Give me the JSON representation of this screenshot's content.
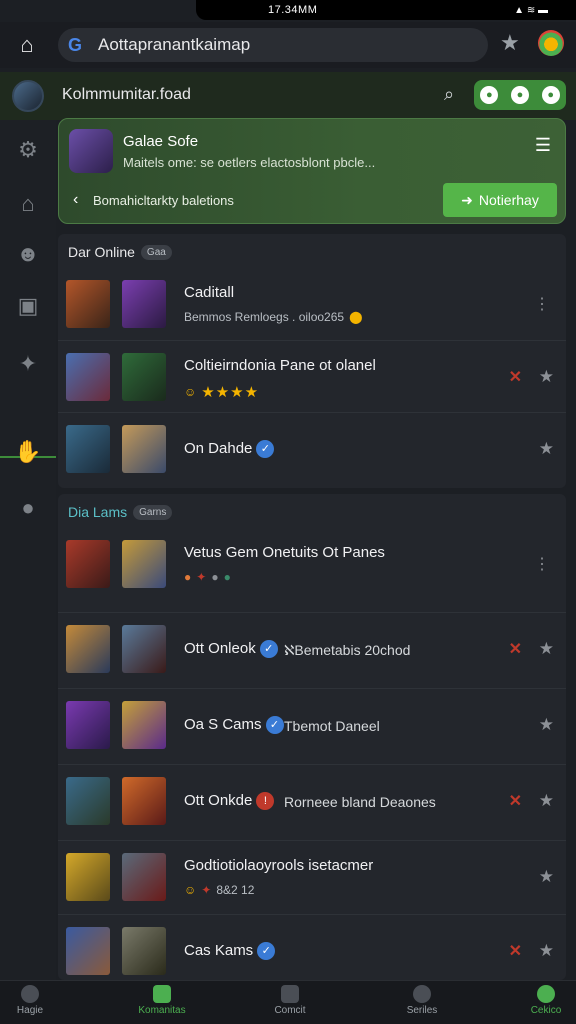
{
  "status_bar": {
    "time": "17.34MM",
    "icons": "▲ ≋ ▬"
  },
  "browser": {
    "url": "Aottapranantkaimap",
    "google_logo": "G",
    "icons": {
      "home": "home-icon",
      "star": "star-icon",
      "extension": "extension-icon"
    }
  },
  "header": {
    "title": "Kolmmumitar.foad",
    "icons": [
      "search-icon",
      "chat-icon",
      "chat-icon",
      "chat-icon"
    ]
  },
  "sidebar": {
    "items": [
      "settings-icon",
      "home-icon",
      "friends-icon",
      "lock-icon",
      "gamepad-icon",
      "thumbs-icon",
      "chat-icon"
    ]
  },
  "banner": {
    "title": "Galae Sofe",
    "subtitle": "Maitels ome: se oetlers elactosblont pbcle...",
    "link": "Bomahicltarkty baletions",
    "button": "Notierhay"
  },
  "section1": {
    "heading": "Dar Online",
    "tag": "Gaa",
    "rows": [
      {
        "name": "Caditall",
        "sub": "Bemmos Remloegs . oiloo265"
      },
      {
        "name": "Coltieirndonia Pane ot olanel",
        "rating": "★★★★"
      },
      {
        "name": "On Dahde"
      }
    ]
  },
  "section2": {
    "heading": "Dia Lams",
    "tag": "Garns",
    "rows": [
      {
        "name": "Vetus Gem Onetuits Ot Panes"
      },
      {
        "name": "Ott Onleok",
        "desc": "ℵBemetabis 20chod"
      },
      {
        "name": "Oa S Cams",
        "desc": "Tbemot Daneel"
      },
      {
        "name": "Ott Onkde",
        "desc": "Rorneee bland Deaones"
      },
      {
        "name": "Godtiotiolaoyrools isetacmer",
        "sub": "8&2 12"
      },
      {
        "name": "Cas Kams"
      }
    ]
  },
  "bottom_nav": {
    "tabs": [
      {
        "label": "Hagie"
      },
      {
        "label": "Komanitas"
      },
      {
        "label": "Comcit"
      },
      {
        "label": "Seriles"
      },
      {
        "label": "Cekico"
      }
    ]
  },
  "colors": {
    "accent": "#3d8c3a",
    "banner_bg": "#2e4a2c",
    "bg": "#1c1f24"
  }
}
